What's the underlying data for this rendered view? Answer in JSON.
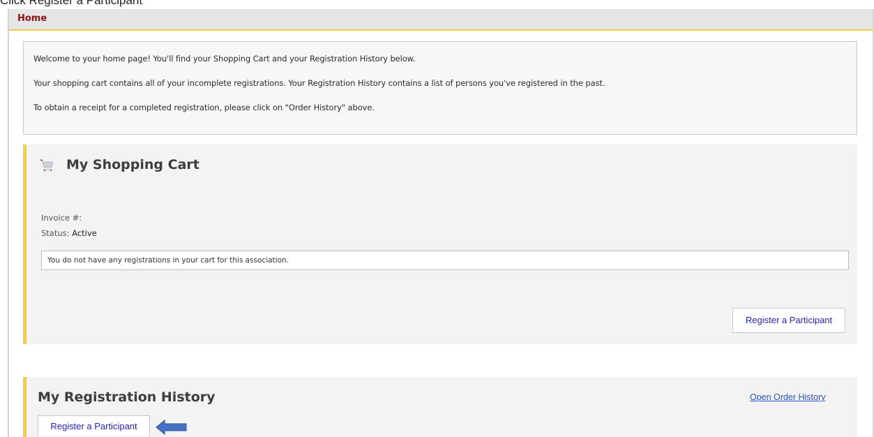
{
  "caption": "Click Register a Participant",
  "header": {
    "title": "Home"
  },
  "welcome": {
    "line1": "Welcome to your home page! You'll find your Shopping Cart and your Registration History below.",
    "line2": "Your shopping cart contains all of your incomplete registrations. Your Registration History contains a list of persons you've registered in the past.",
    "line3": "To obtain a receipt for a completed registration, please click on \"Order History\" above."
  },
  "cart": {
    "icon": "shopping-cart-icon",
    "title": "My Shopping Cart",
    "invoice_label": "Invoice #:",
    "invoice_value": "",
    "status_label": "Status:",
    "status_value": "Active",
    "empty_message": "You do not have any registrations in your cart for this association.",
    "register_button": "Register a Participant"
  },
  "history": {
    "title": "My Registration History",
    "order_history_link": "Open Order History",
    "register_button": "Register a Participant",
    "pointer_icon": "left-arrow-icon"
  },
  "colors": {
    "title_red": "#8b1414",
    "accent_yellow": "#f6cf3a",
    "link_blue": "#2a52d6",
    "button_text": "#2323c8",
    "arrow_blue": "#4472c4"
  }
}
